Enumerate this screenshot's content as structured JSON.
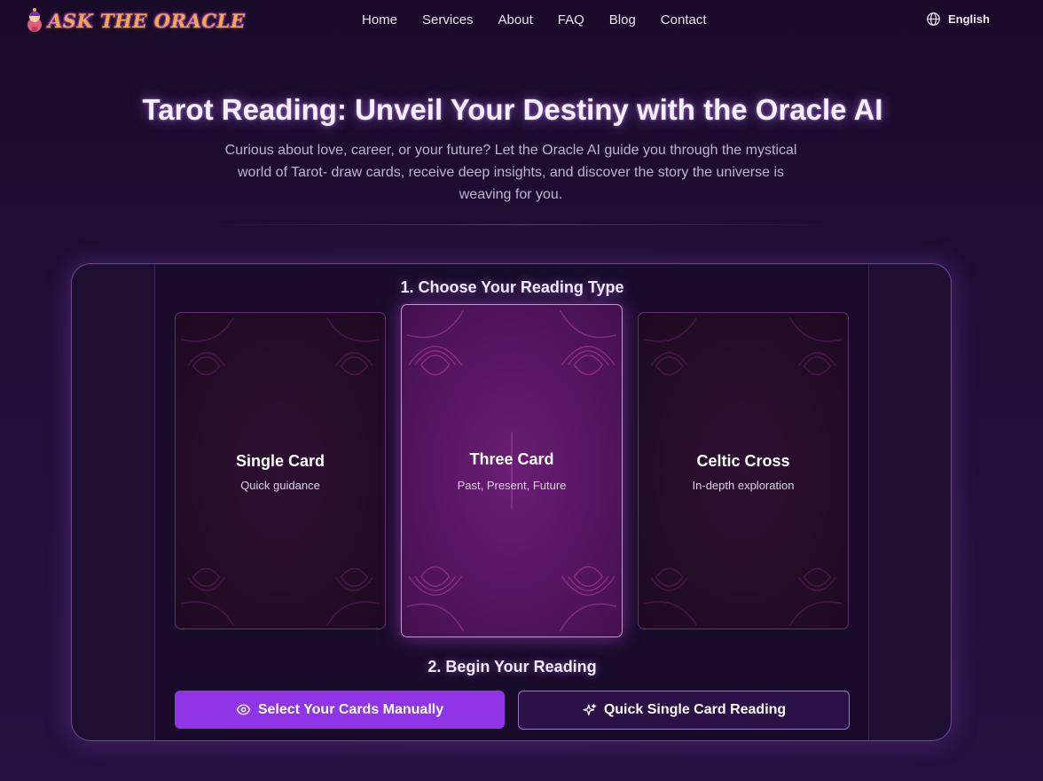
{
  "brand": {
    "logo_text": "ASK THE ORACLE",
    "logo_icon": "oracle-mascot-icon"
  },
  "nav": {
    "items": [
      {
        "label": "Home"
      },
      {
        "label": "Services"
      },
      {
        "label": "About"
      },
      {
        "label": "FAQ"
      },
      {
        "label": "Blog"
      },
      {
        "label": "Contact"
      }
    ]
  },
  "language": {
    "icon": "globe-icon",
    "label": "English"
  },
  "hero": {
    "title": "Tarot Reading: Unveil Your Destiny with the Oracle AI",
    "subtitle": "Curious about love, career, or your future? Let the Oracle AI guide you through the mystical world of Tarot- draw cards, receive deep insights, and discover the story the universe is weaving for you."
  },
  "reading": {
    "step1_title": "1. Choose Your Reading Type",
    "types": [
      {
        "title": "Single Card",
        "subtitle": "Quick guidance",
        "selected": false
      },
      {
        "title": "Three Card",
        "subtitle": "Past, Present, Future",
        "selected": true
      },
      {
        "title": "Celtic Cross",
        "subtitle": "In-depth exploration",
        "selected": false
      }
    ],
    "step2_title": "2. Begin Your Reading",
    "buttons": {
      "manual": {
        "label": "Select Your Cards Manually",
        "icon": "eye-icon"
      },
      "quick": {
        "label": "Quick Single Card Reading",
        "icon": "sparkle-icon"
      }
    }
  },
  "colors": {
    "background": "#1c0d2e",
    "accent": "#8f34e6",
    "selected_card": "#5a1764",
    "logo_gold": "#f3a94a"
  }
}
